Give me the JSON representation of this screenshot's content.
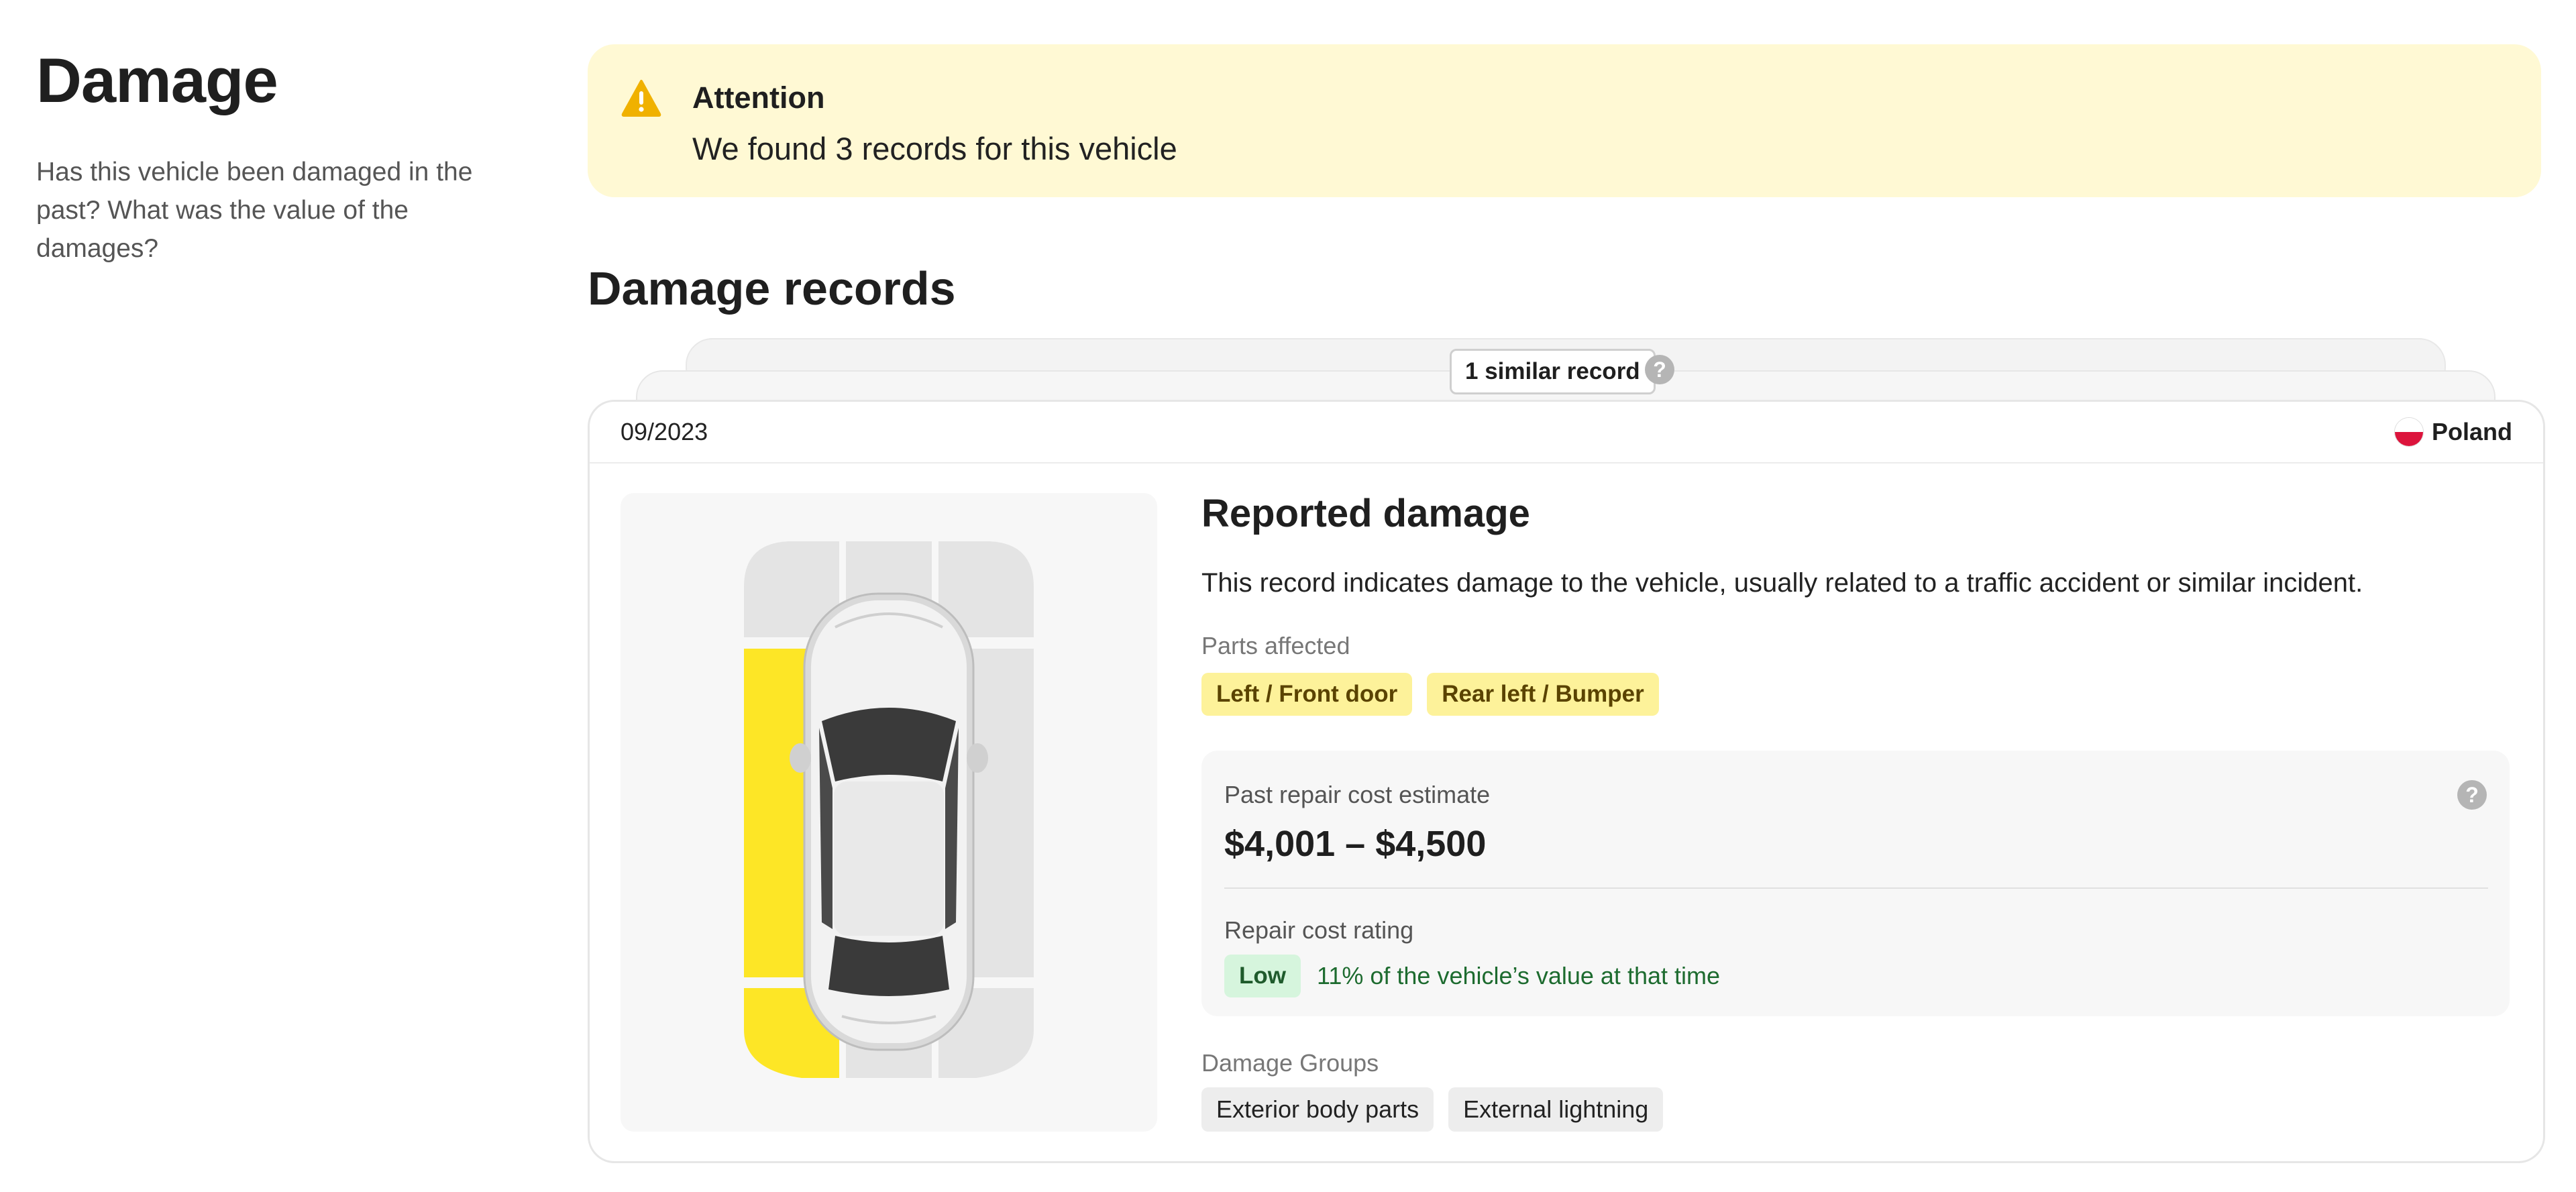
{
  "sidebar": {
    "title": "Damage",
    "description": "Has this vehicle been damaged in the past? What was the value of the damages?"
  },
  "banner": {
    "title": "Attention",
    "text": "We found 3 records for this vehicle",
    "icon": "warning-icon",
    "color": "#fff9d4"
  },
  "section": {
    "title": "Damage records"
  },
  "stack": {
    "similar_label": "1 similar record",
    "help_icon": "?"
  },
  "record": {
    "date": "09/2023",
    "country": "Poland",
    "title": "Reported damage",
    "description": "This record indicates damage to the vehicle, usually related to a traffic accident or similar incident.",
    "parts_label": "Parts affected",
    "parts": [
      "Left / Front door",
      "Rear left / Bumper"
    ],
    "cost_label": "Past repair cost estimate",
    "cost_value": "$4,001 – $4,500",
    "cost_help": "?",
    "rating_label": "Repair cost rating",
    "rating_badge": "Low",
    "rating_text": "11% of the vehicle’s value at that time",
    "groups_label": "Damage Groups",
    "groups": [
      "Exterior body parts",
      "External lightning"
    ],
    "highlight_color": "#fde626"
  }
}
